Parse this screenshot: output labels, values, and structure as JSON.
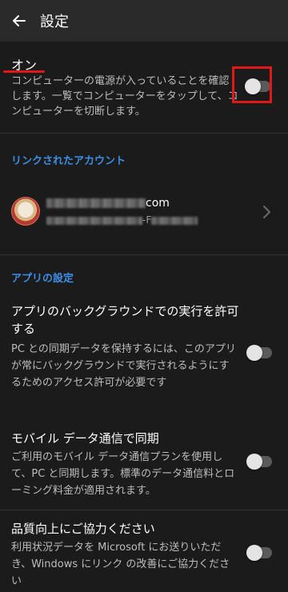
{
  "app_bar": {
    "title": "設定",
    "back_icon": "arrow-left-icon"
  },
  "connection": {
    "title": "オン",
    "description": "コンピューターの電源が入っていることを確認します。一覧でコンピューターをタップして、コンピューターを切断します。",
    "toggle_on": false,
    "highlight_color": "#e01818"
  },
  "linked_accounts": {
    "header": "リンクされたアカウント",
    "account": {
      "email_suffix": "com",
      "subtitle_visible": "-F",
      "chevron_icon": "chevron-right-icon"
    }
  },
  "app_settings": {
    "header": "アプリの設定",
    "items": [
      {
        "title": "アプリのバックグラウンドでの実行を許可する",
        "description": "PC との同期データを保持するには、このアプリが常にバックグラウンドで実行されるようにするためのアクセス許可が必要です",
        "toggle_on": false
      },
      {
        "title": "モバイル データ通信で同期",
        "description": "ご利用のモバイル データ通信プランを使用して、PC と同期します。標準のデータ通信料とローミング料金が適用されます。",
        "toggle_on": false
      },
      {
        "title": "品質向上にご協力ください",
        "description": "利用状況データを Microsoft にお送りいただき、Windows にリンク の改善にご協力ください",
        "toggle_on": false
      }
    ]
  },
  "colors": {
    "background": "#1b1b1b",
    "app_bar": "#2a2a2a",
    "accent": "#3b8ee8",
    "annotation": "#e01818"
  }
}
